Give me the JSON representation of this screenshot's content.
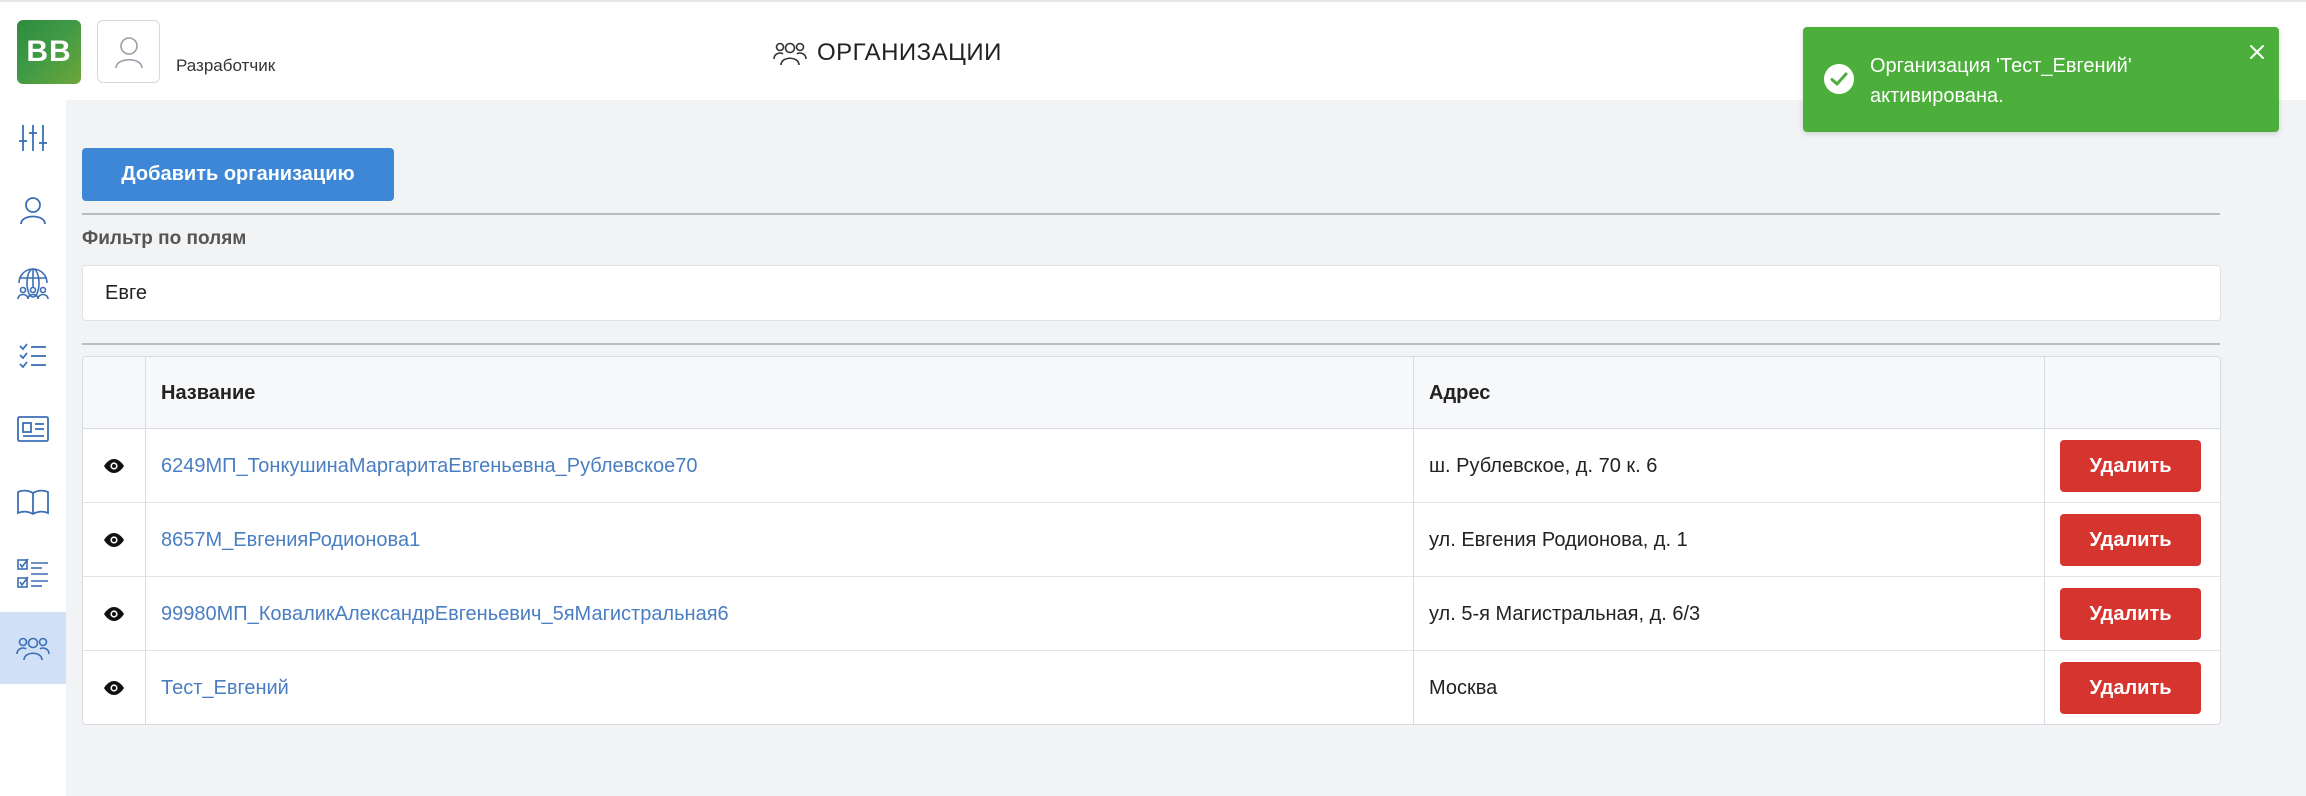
{
  "header": {
    "logo_text": "BB",
    "role": "Разработчик",
    "page_title": "ОРГАНИЗАЦИИ"
  },
  "sidebar": {
    "items": [
      {
        "icon": "sliders-icon"
      },
      {
        "icon": "user-icon"
      },
      {
        "icon": "globe-users-icon"
      },
      {
        "icon": "checklist-icon"
      },
      {
        "icon": "id-card-icon"
      },
      {
        "icon": "book-icon"
      },
      {
        "icon": "tasks-icon"
      },
      {
        "icon": "organizations-icon",
        "active": true
      }
    ]
  },
  "main": {
    "add_button": "Добавить организацию",
    "filter_label": "Фильтр по полям",
    "filter_value": "Евге"
  },
  "table": {
    "headers": [
      "Название",
      "Адрес"
    ],
    "rows": [
      {
        "name": "6249МП_ТонкушинаМаргаритаЕвгеньевна_Рублевское70",
        "address": "ш. Рублевское, д. 70 к. 6",
        "delete": "Удалить"
      },
      {
        "name": "8657М_ЕвгенияРодионова1",
        "address": "ул. Евгения Родионова, д. 1",
        "delete": "Удалить"
      },
      {
        "name": "99980МП_КоваликАлександрЕвгеньевич_5яМагистральная6",
        "address": "ул. 5-я Магистральная, д. 6/3",
        "delete": "Удалить"
      },
      {
        "name": "Тест_Евгений",
        "address": "Москва",
        "delete": "Удалить"
      }
    ]
  },
  "toast": {
    "message": "Организация 'Тест_Евгений' активирована."
  },
  "colors": {
    "primary": "#3d87d6",
    "danger": "#d6342f",
    "success": "#4caf3b",
    "link": "#4a7ec2",
    "active_nav": "#cfe0f7"
  }
}
